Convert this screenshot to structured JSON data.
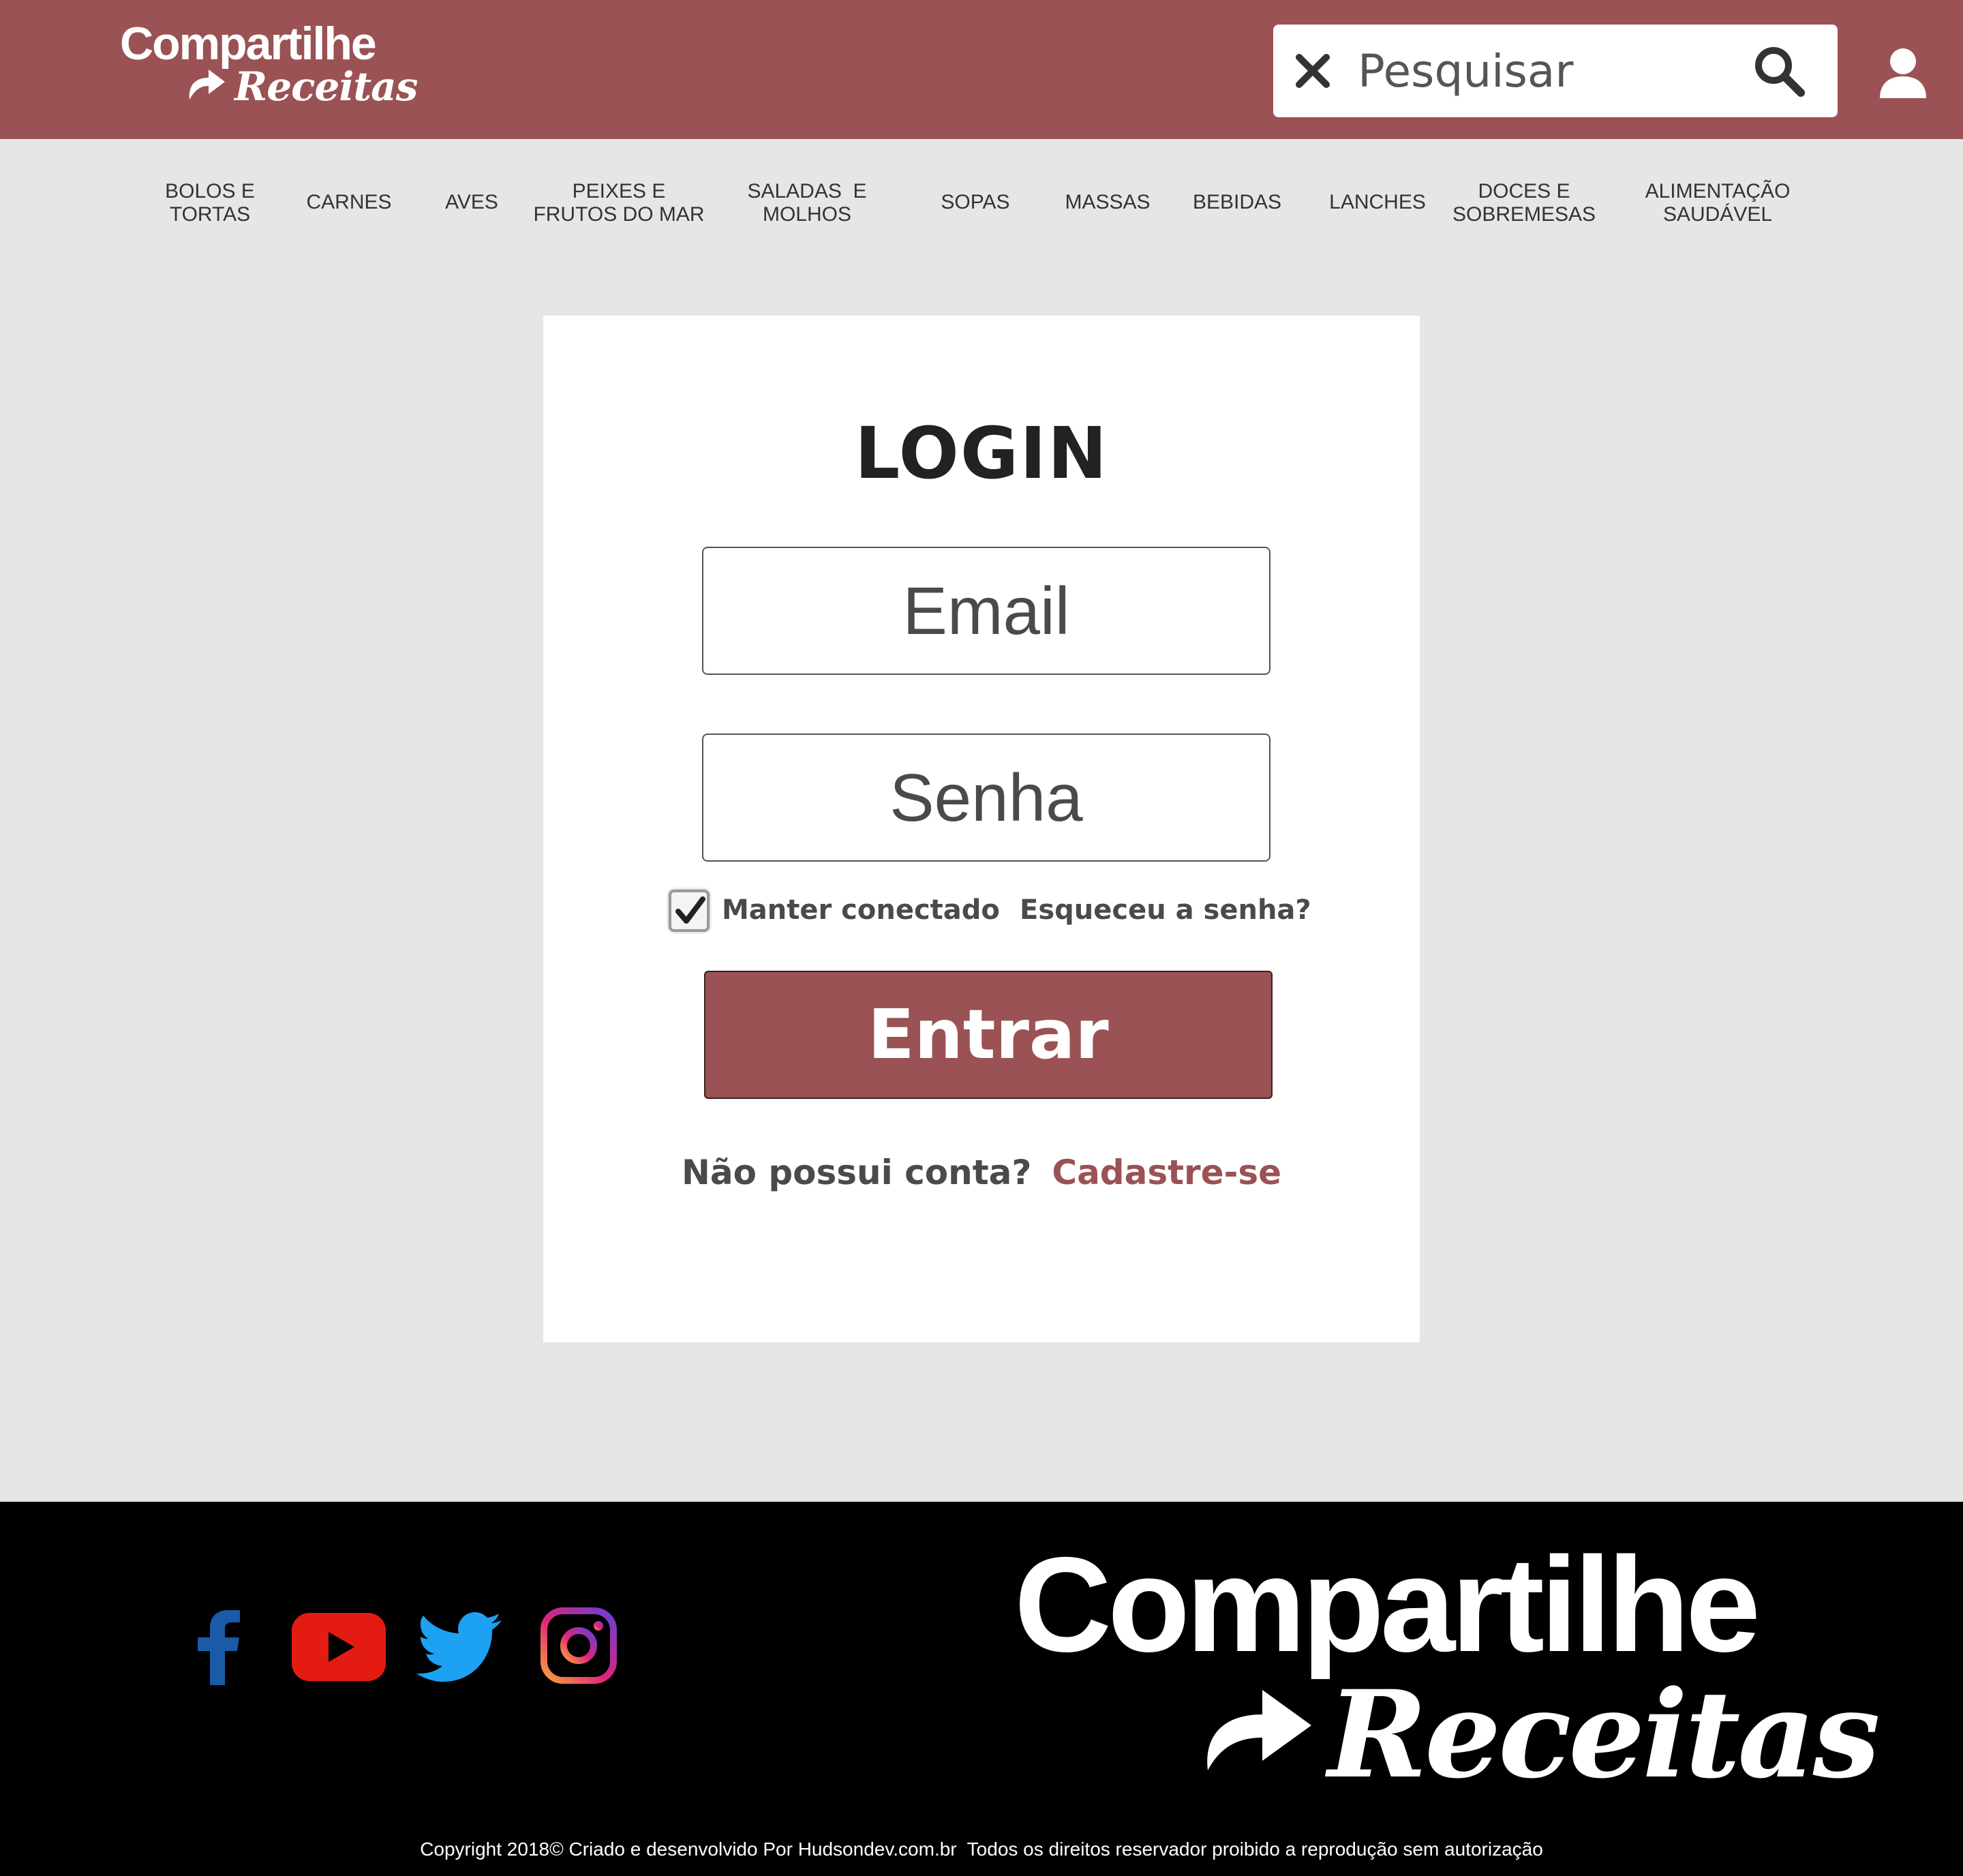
{
  "header": {
    "logo_line1": "Compartilhe",
    "logo_line2": "Receitas",
    "search_placeholder": "Pesquisar",
    "bg_color": "#9a5254"
  },
  "nav": {
    "items": [
      {
        "label": "BOLOS E\nTORTAS"
      },
      {
        "label": "CARNES"
      },
      {
        "label": "AVES"
      },
      {
        "label": "PEIXES E\nFRUTOS DO MAR"
      },
      {
        "label": "SALADAS  E\nMOLHOS"
      },
      {
        "label": "SOPAS"
      },
      {
        "label": "MASSAS"
      },
      {
        "label": "BEBIDAS"
      },
      {
        "label": "LANCHES"
      },
      {
        "label": "DOCES E\nSOBREMESAS"
      },
      {
        "label": "ALIMENTAÇÃO\nSAUDÁVEL"
      }
    ]
  },
  "login": {
    "title": "LOGIN",
    "email_placeholder": "Email",
    "password_placeholder": "Senha",
    "remember_label": "Manter conectado",
    "remember_checked": true,
    "forgot_label": "Esqueceu a senha?",
    "submit_label": "Entrar",
    "signup_prompt": "Não possui conta?",
    "signup_link": "Cadastre-se"
  },
  "footer": {
    "social_icons": [
      "facebook-icon",
      "youtube-icon",
      "twitter-icon",
      "instagram-icon"
    ],
    "logo_line1": "Compartilhe",
    "logo_line2": "Receitas",
    "copyright": "Copyright 2018© Criado e desenvolvido Por Hudsondev.com.br  Todos os direitos reservador proibido a reprodução sem autorização"
  },
  "colors": {
    "brand": "#9a5254",
    "page_bg": "#e6e6e6",
    "footer_bg": "#000000",
    "facebook": "#1a5aa6",
    "youtube": "#e41b13",
    "twitter": "#1da1f2"
  }
}
